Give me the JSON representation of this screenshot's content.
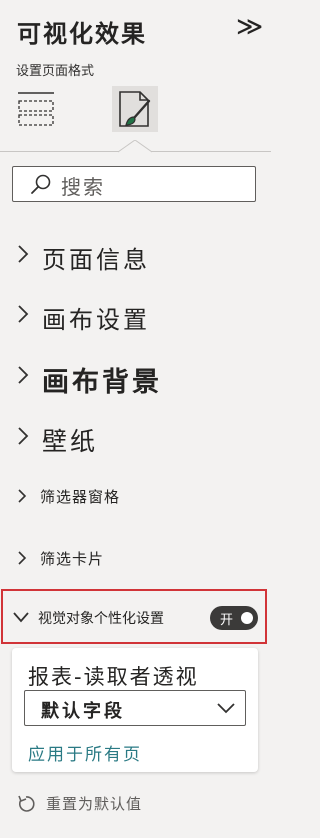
{
  "pane": {
    "title": "可视化效果",
    "collapse_glyph": "≫",
    "subtitle": "设置页面格式"
  },
  "search": {
    "placeholder": "搜索"
  },
  "sections": [
    {
      "label": "页面信息"
    },
    {
      "label": "画布设置"
    },
    {
      "label": "画布背景"
    },
    {
      "label": "壁纸"
    },
    {
      "label": "筛选器窗格"
    },
    {
      "label": "筛选卡片"
    },
    {
      "label": "视觉对象个性化设置"
    }
  ],
  "personalize": {
    "toggle_label": "开",
    "toggle_on": true,
    "card_title": "报表-读取者透视",
    "dropdown_value": "默认字段",
    "apply_link": "应用于所有页"
  },
  "reset": {
    "label": "重置为默认值"
  },
  "colors": {
    "highlight": "#d13438",
    "link": "#2a7a84",
    "toggle": "#3b3a39"
  }
}
